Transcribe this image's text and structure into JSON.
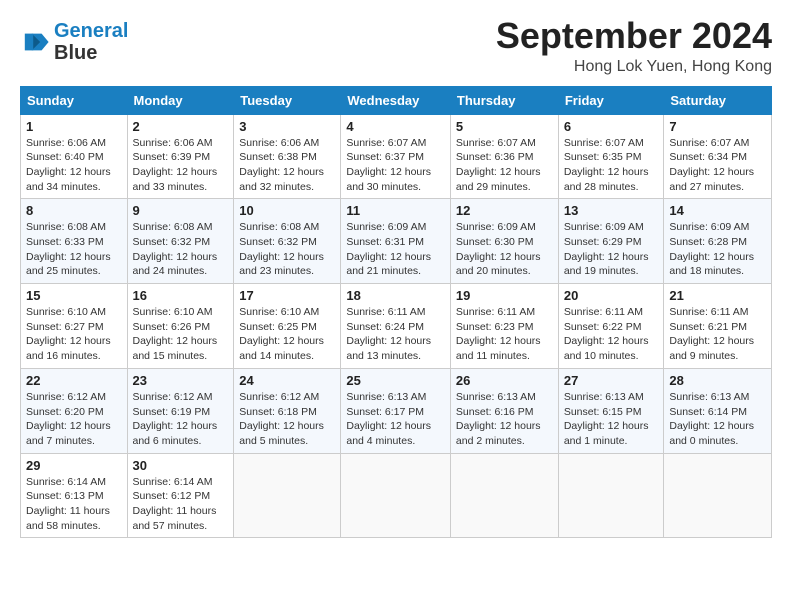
{
  "logo": {
    "line1": "General",
    "line2": "Blue"
  },
  "header": {
    "month": "September 2024",
    "location": "Hong Lok Yuen, Hong Kong"
  },
  "weekdays": [
    "Sunday",
    "Monday",
    "Tuesday",
    "Wednesday",
    "Thursday",
    "Friday",
    "Saturday"
  ],
  "weeks": [
    [
      {
        "day": "1",
        "info": "Sunrise: 6:06 AM\nSunset: 6:40 PM\nDaylight: 12 hours\nand 34 minutes."
      },
      {
        "day": "2",
        "info": "Sunrise: 6:06 AM\nSunset: 6:39 PM\nDaylight: 12 hours\nand 33 minutes."
      },
      {
        "day": "3",
        "info": "Sunrise: 6:06 AM\nSunset: 6:38 PM\nDaylight: 12 hours\nand 32 minutes."
      },
      {
        "day": "4",
        "info": "Sunrise: 6:07 AM\nSunset: 6:37 PM\nDaylight: 12 hours\nand 30 minutes."
      },
      {
        "day": "5",
        "info": "Sunrise: 6:07 AM\nSunset: 6:36 PM\nDaylight: 12 hours\nand 29 minutes."
      },
      {
        "day": "6",
        "info": "Sunrise: 6:07 AM\nSunset: 6:35 PM\nDaylight: 12 hours\nand 28 minutes."
      },
      {
        "day": "7",
        "info": "Sunrise: 6:07 AM\nSunset: 6:34 PM\nDaylight: 12 hours\nand 27 minutes."
      }
    ],
    [
      {
        "day": "8",
        "info": "Sunrise: 6:08 AM\nSunset: 6:33 PM\nDaylight: 12 hours\nand 25 minutes."
      },
      {
        "day": "9",
        "info": "Sunrise: 6:08 AM\nSunset: 6:32 PM\nDaylight: 12 hours\nand 24 minutes."
      },
      {
        "day": "10",
        "info": "Sunrise: 6:08 AM\nSunset: 6:32 PM\nDaylight: 12 hours\nand 23 minutes."
      },
      {
        "day": "11",
        "info": "Sunrise: 6:09 AM\nSunset: 6:31 PM\nDaylight: 12 hours\nand 21 minutes."
      },
      {
        "day": "12",
        "info": "Sunrise: 6:09 AM\nSunset: 6:30 PM\nDaylight: 12 hours\nand 20 minutes."
      },
      {
        "day": "13",
        "info": "Sunrise: 6:09 AM\nSunset: 6:29 PM\nDaylight: 12 hours\nand 19 minutes."
      },
      {
        "day": "14",
        "info": "Sunrise: 6:09 AM\nSunset: 6:28 PM\nDaylight: 12 hours\nand 18 minutes."
      }
    ],
    [
      {
        "day": "15",
        "info": "Sunrise: 6:10 AM\nSunset: 6:27 PM\nDaylight: 12 hours\nand 16 minutes."
      },
      {
        "day": "16",
        "info": "Sunrise: 6:10 AM\nSunset: 6:26 PM\nDaylight: 12 hours\nand 15 minutes."
      },
      {
        "day": "17",
        "info": "Sunrise: 6:10 AM\nSunset: 6:25 PM\nDaylight: 12 hours\nand 14 minutes."
      },
      {
        "day": "18",
        "info": "Sunrise: 6:11 AM\nSunset: 6:24 PM\nDaylight: 12 hours\nand 13 minutes."
      },
      {
        "day": "19",
        "info": "Sunrise: 6:11 AM\nSunset: 6:23 PM\nDaylight: 12 hours\nand 11 minutes."
      },
      {
        "day": "20",
        "info": "Sunrise: 6:11 AM\nSunset: 6:22 PM\nDaylight: 12 hours\nand 10 minutes."
      },
      {
        "day": "21",
        "info": "Sunrise: 6:11 AM\nSunset: 6:21 PM\nDaylight: 12 hours\nand 9 minutes."
      }
    ],
    [
      {
        "day": "22",
        "info": "Sunrise: 6:12 AM\nSunset: 6:20 PM\nDaylight: 12 hours\nand 7 minutes."
      },
      {
        "day": "23",
        "info": "Sunrise: 6:12 AM\nSunset: 6:19 PM\nDaylight: 12 hours\nand 6 minutes."
      },
      {
        "day": "24",
        "info": "Sunrise: 6:12 AM\nSunset: 6:18 PM\nDaylight: 12 hours\nand 5 minutes."
      },
      {
        "day": "25",
        "info": "Sunrise: 6:13 AM\nSunset: 6:17 PM\nDaylight: 12 hours\nand 4 minutes."
      },
      {
        "day": "26",
        "info": "Sunrise: 6:13 AM\nSunset: 6:16 PM\nDaylight: 12 hours\nand 2 minutes."
      },
      {
        "day": "27",
        "info": "Sunrise: 6:13 AM\nSunset: 6:15 PM\nDaylight: 12 hours\nand 1 minute."
      },
      {
        "day": "28",
        "info": "Sunrise: 6:13 AM\nSunset: 6:14 PM\nDaylight: 12 hours\nand 0 minutes."
      }
    ],
    [
      {
        "day": "29",
        "info": "Sunrise: 6:14 AM\nSunset: 6:13 PM\nDaylight: 11 hours\nand 58 minutes."
      },
      {
        "day": "30",
        "info": "Sunrise: 6:14 AM\nSunset: 6:12 PM\nDaylight: 11 hours\nand 57 minutes."
      },
      {
        "day": "",
        "info": ""
      },
      {
        "day": "",
        "info": ""
      },
      {
        "day": "",
        "info": ""
      },
      {
        "day": "",
        "info": ""
      },
      {
        "day": "",
        "info": ""
      }
    ]
  ]
}
